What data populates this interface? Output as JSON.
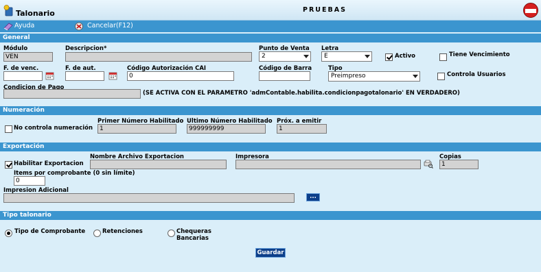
{
  "header": {
    "title": "Talonario",
    "environment": "PRUEBAS",
    "badge_text": "PRUEBAS"
  },
  "toolbar": {
    "help_label": "Ayuda",
    "cancel_label": "Cancelar(F12)"
  },
  "general": {
    "section_title": "General",
    "modulo_label": "Módulo",
    "modulo_value": "VEN",
    "descripcion_label": "Descripcion*",
    "descripcion_value": "",
    "punto_venta_label": "Punto de Venta",
    "punto_venta_value": "2",
    "letra_label": "Letra",
    "letra_value": "E",
    "activo_label": "Activo",
    "activo_checked": true,
    "tiene_venc_label": "Tiene Vencimiento",
    "tiene_venc_checked": false,
    "f_venc_label": "F. de venc.",
    "f_venc_value": "",
    "f_aut_label": "F. de aut.",
    "f_aut_value": "",
    "cai_label": "Código Autorización CAI",
    "cai_value": "0",
    "codigo_barra_label": "Código de Barra",
    "codigo_barra_value": "",
    "tipo_label": "Tipo",
    "tipo_value": "Preimpreso",
    "controla_usuarios_label": "Controla Usuarios",
    "controla_usuarios_checked": false,
    "condicion_pago_label": "Condicion de Pago",
    "condicion_pago_value": "",
    "condicion_pago_note": "(SE ACTIVA CON EL PARAMETRO 'admContable.habilita.condicionpagotalonario' EN VERDADERO)"
  },
  "numeracion": {
    "section_title": "Numeración",
    "no_controla_label": "No controla numeración",
    "no_controla_checked": false,
    "primer_label": "Primer Número Habilitado",
    "primer_value": "1",
    "ultimo_label": "Ultimo Número Habilitado",
    "ultimo_value": "999999999",
    "proximo_label": "Próx. a emitir",
    "proximo_value": "1"
  },
  "exportacion": {
    "section_title": "Exportación",
    "habilitar_label": "Habilitar Exportacion",
    "habilitar_checked": true,
    "nombre_archivo_label": "Nombre Archivo Exportacion",
    "nombre_archivo_value": "",
    "impresora_label": "Impresora",
    "impresora_value": "",
    "copias_label": "Copias",
    "copias_value": "1",
    "items_label": "Items por comprobante (0 sin límite)",
    "items_value": "0",
    "impresion_adicional_label": "Impresion Adicional",
    "impresion_adicional_value": "",
    "browse_label": "..."
  },
  "tipo_talonario": {
    "section_title": "Tipo talonario",
    "options": [
      {
        "label": "Tipo de Comprobante",
        "selected": true
      },
      {
        "label": "Retenciones",
        "selected": false
      },
      {
        "label": "Chequeras Bancarias",
        "selected": false
      }
    ],
    "chequeras_line1": "Chequeras",
    "chequeras_line2": "Bancarias"
  },
  "actions": {
    "save_label": "Guardar"
  },
  "colors": {
    "title_bar": "#d7ecf7",
    "toolbar": "#3b95cf",
    "section": "#3b95cf",
    "background": "#daeef9",
    "button": "#0d3f8a"
  }
}
